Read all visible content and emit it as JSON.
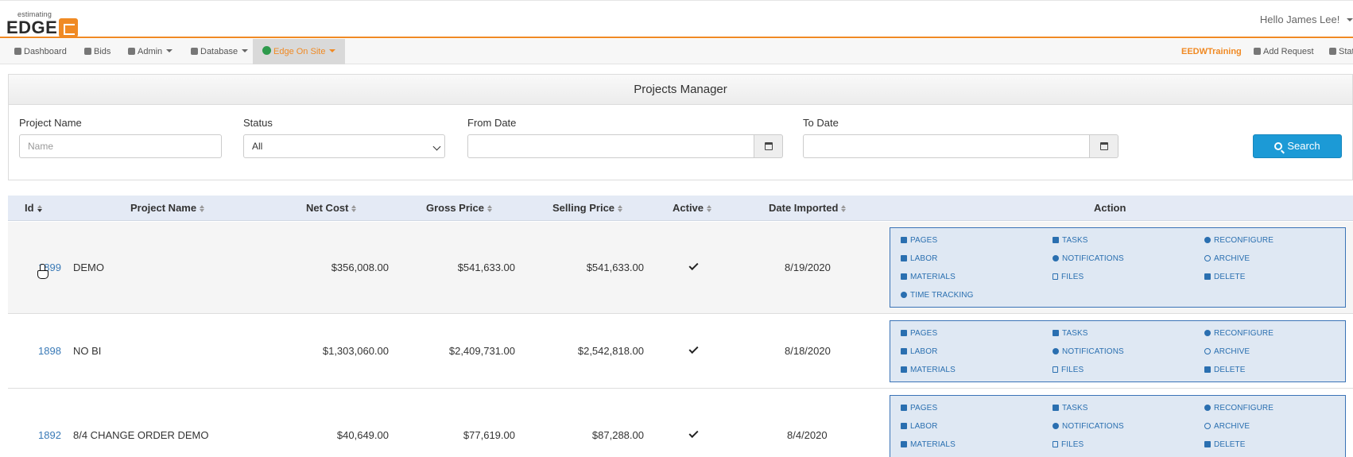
{
  "header": {
    "logo_small": "estimating",
    "logo_big": "EDGE",
    "greeting": "Hello James Lee!"
  },
  "nav": {
    "left": [
      {
        "label": "Dashboard",
        "icon": "dashboard-icon"
      },
      {
        "label": "Bids",
        "icon": "bids-icon"
      },
      {
        "label": "Admin",
        "icon": "admin-users-icon",
        "dropdown": true
      },
      {
        "label": "Database",
        "icon": "database-icon",
        "dropdown": true
      },
      {
        "label": "Edge On Site",
        "icon": "edge-onsite-icon",
        "dropdown": true,
        "active": true
      }
    ],
    "right": [
      {
        "label": "EEDWTraining"
      },
      {
        "label": "Add Request",
        "icon": "add-request-icon"
      },
      {
        "label": "Stat",
        "icon": "status-check-icon"
      }
    ]
  },
  "panel": {
    "title": "Projects Manager",
    "project_name_label": "Project Name",
    "project_name_placeholder": "Name",
    "status_label": "Status",
    "status_value": "All",
    "from_date_label": "From Date",
    "to_date_label": "To Date",
    "search_label": "Search"
  },
  "table": {
    "headers": [
      "Id",
      "Project Name",
      "Net Cost",
      "Gross Price",
      "Selling Price",
      "Active",
      "Date Imported",
      "Action"
    ],
    "rows": [
      {
        "id": "1899",
        "name": "DEMO",
        "net_cost": "$356,008.00",
        "gross_price": "$541,633.00",
        "selling_price": "$541,633.00",
        "active": true,
        "date": "8/19/2020"
      },
      {
        "id": "1898",
        "name": "NO BI",
        "net_cost": "$1,303,060.00",
        "gross_price": "$2,409,731.00",
        "selling_price": "$2,542,818.00",
        "active": true,
        "date": "8/18/2020"
      },
      {
        "id": "1892",
        "name": "8/4 CHANGE ORDER DEMO",
        "net_cost": "$40,649.00",
        "gross_price": "$77,619.00",
        "selling_price": "$87,288.00",
        "active": true,
        "date": "8/4/2020"
      }
    ]
  },
  "actions": {
    "pages": "PAGES",
    "tasks": "TASKS",
    "reconfigure": "RECONFIGURE",
    "labor": "LABOR",
    "notifications": "NOTIFICATIONS",
    "archive": "ARCHIVE",
    "materials": "MATERIALS",
    "files": "FILES",
    "delete": "DELETE",
    "time_tracking": "TIME TRACKING"
  },
  "colors": {
    "accent": "#f08a24",
    "link": "#3a7ab7",
    "action_blue": "#2a6fb0",
    "search_button": "#1c9ad6",
    "table_header": "#e4eaf5"
  }
}
